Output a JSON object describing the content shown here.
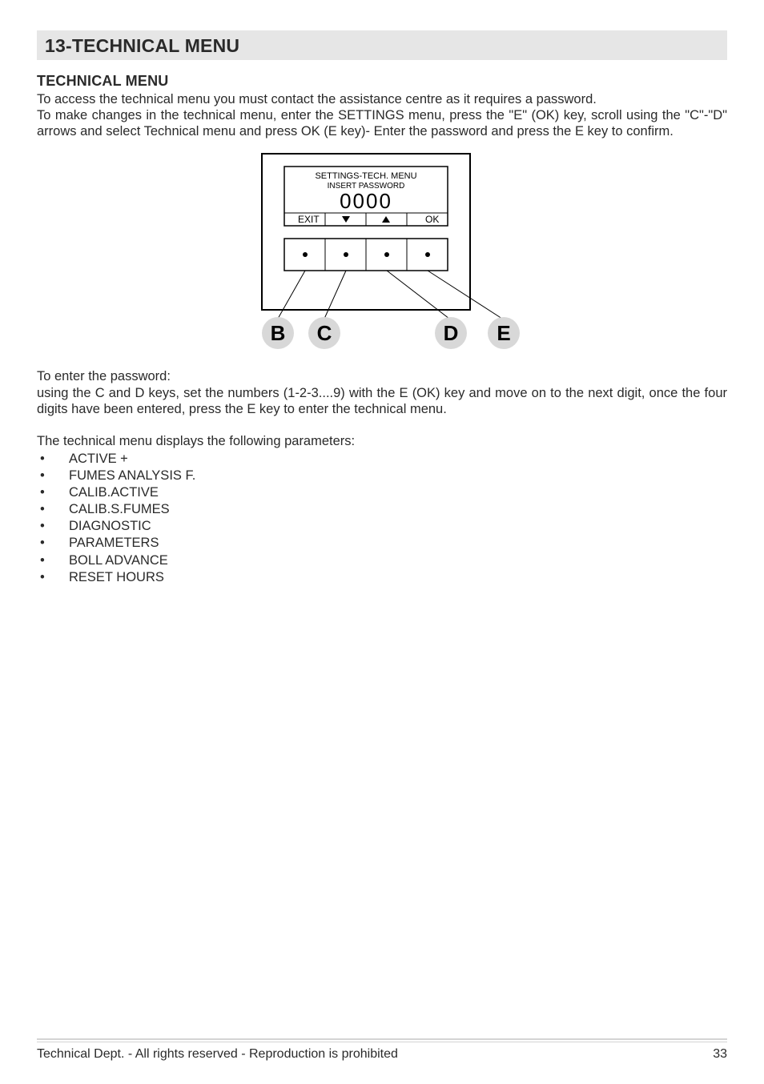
{
  "header": {
    "title": "13-TECHNICAL MENU"
  },
  "section": {
    "heading": "TECHNICAL MENU",
    "intro_line1": "To access the technical menu you must contact the assistance centre as it requires a password.",
    "intro_line2": "To make changes in the technical menu, enter the SETTINGS menu, press the \"E\" (OK) key, scroll using the \"C\"-\"D\" arrows and select Technical menu and press OK (E key)- Enter the password and press the E key to confirm.",
    "enter_pw_heading": "To enter the password:",
    "enter_pw_body": "using the C and D keys, set the numbers (1-2-3....9) with the E (OK) key and move on to the next digit, once the four digits have been entered, press the E key to enter the technical menu.",
    "list_intro": "The technical menu displays the following parameters:",
    "items": [
      "ACTIVE +",
      "FUMES ANALYSIS F.",
      "CALIB.ACTIVE",
      "CALIB.S.FUMES",
      "DIAGNOSTIC",
      "PARAMETERS",
      "BOLL ADVANCE",
      "RESET HOURS"
    ]
  },
  "diagram": {
    "screen_line1": "SETTINGS-TECH. MENU",
    "screen_line2": "INSERT PASSWORD",
    "screen_value": "0000",
    "softkey_left": "EXIT",
    "softkey_right": "OK",
    "labels": {
      "b": "B",
      "c": "C",
      "d": "D",
      "e": "E"
    }
  },
  "footer": {
    "left": "Technical Dept. - All rights reserved - Reproduction is prohibited",
    "page": "33"
  }
}
